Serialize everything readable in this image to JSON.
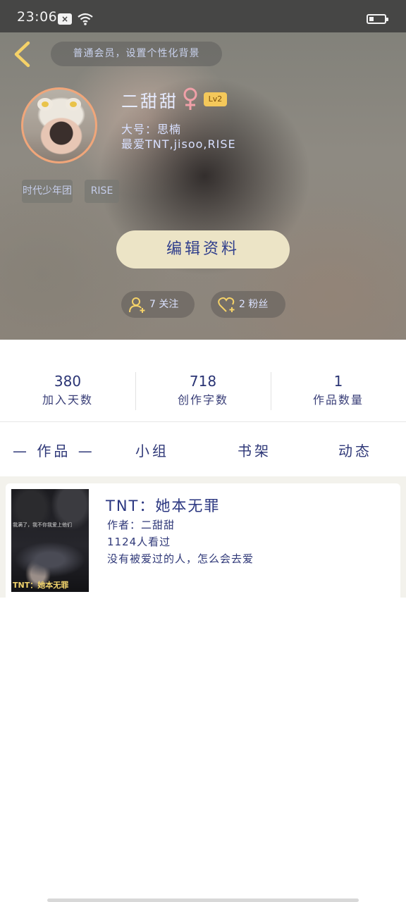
{
  "status_bar": {
    "time": "23:06"
  },
  "header": {
    "banner": "普通会员，设置个性化背景",
    "username": "二甜甜",
    "gender_symbol": "♀",
    "level": "Lv2",
    "bio_line1": "大号：思楠",
    "bio_line2": "最爱TNT,jisoo,RISE",
    "tags": [
      "时代少年团",
      "RISE"
    ],
    "edit_button": "编辑资料",
    "follow_label": "7 关注",
    "fans_label": "2 粉丝"
  },
  "stats": [
    {
      "value": "380",
      "label": "加入天数"
    },
    {
      "value": "718",
      "label": "创作字数"
    },
    {
      "value": "1",
      "label": "作品数量"
    }
  ],
  "tabs": [
    "— 作品 —",
    "小组",
    "书架",
    "动态"
  ],
  "works": [
    {
      "title": "TNT：她本无罪",
      "author": "作者：二甜甜",
      "views": "1124人看过",
      "description": "没有被爱过的人，怎么会去爱",
      "cover_text": "TNT：她本无罪",
      "cover_caption": "我满了，我不你我爱上他们"
    }
  ],
  "colors": {
    "accent_text": "#2f3878",
    "edit_button_bg": "#ece4c6",
    "level_badge": "#f4c85a"
  }
}
